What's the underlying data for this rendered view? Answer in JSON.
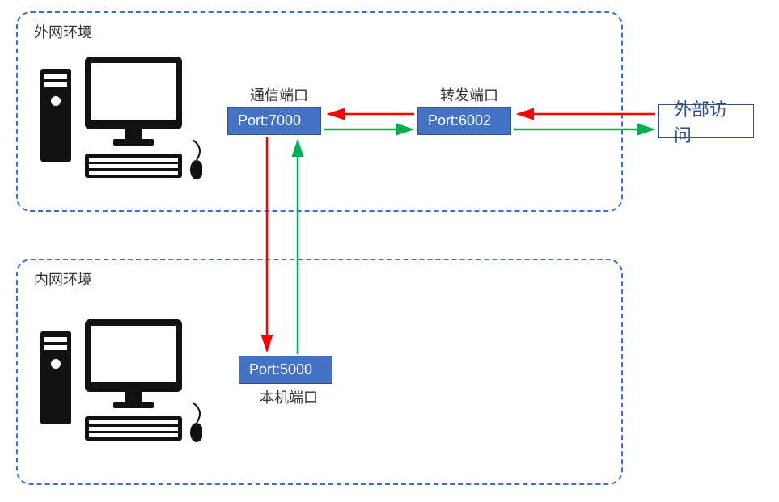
{
  "zones": {
    "outer": {
      "label": "外网环境"
    },
    "inner": {
      "label": "内网环境"
    }
  },
  "labels": {
    "comm_port_title": "通信端口",
    "forward_port_title": "转发端口",
    "local_port_title": "本机端口"
  },
  "boxes": {
    "port7000": "Port:7000",
    "port6002": "Port:6002",
    "port5000": "Port:5000",
    "external": "外部访问"
  },
  "colors": {
    "zone_border": "#3a6fd8",
    "box_fill": "#4472C4",
    "box_border": "#2F528F",
    "arrow_red": "#FF0000",
    "arrow_green": "#00B050"
  }
}
